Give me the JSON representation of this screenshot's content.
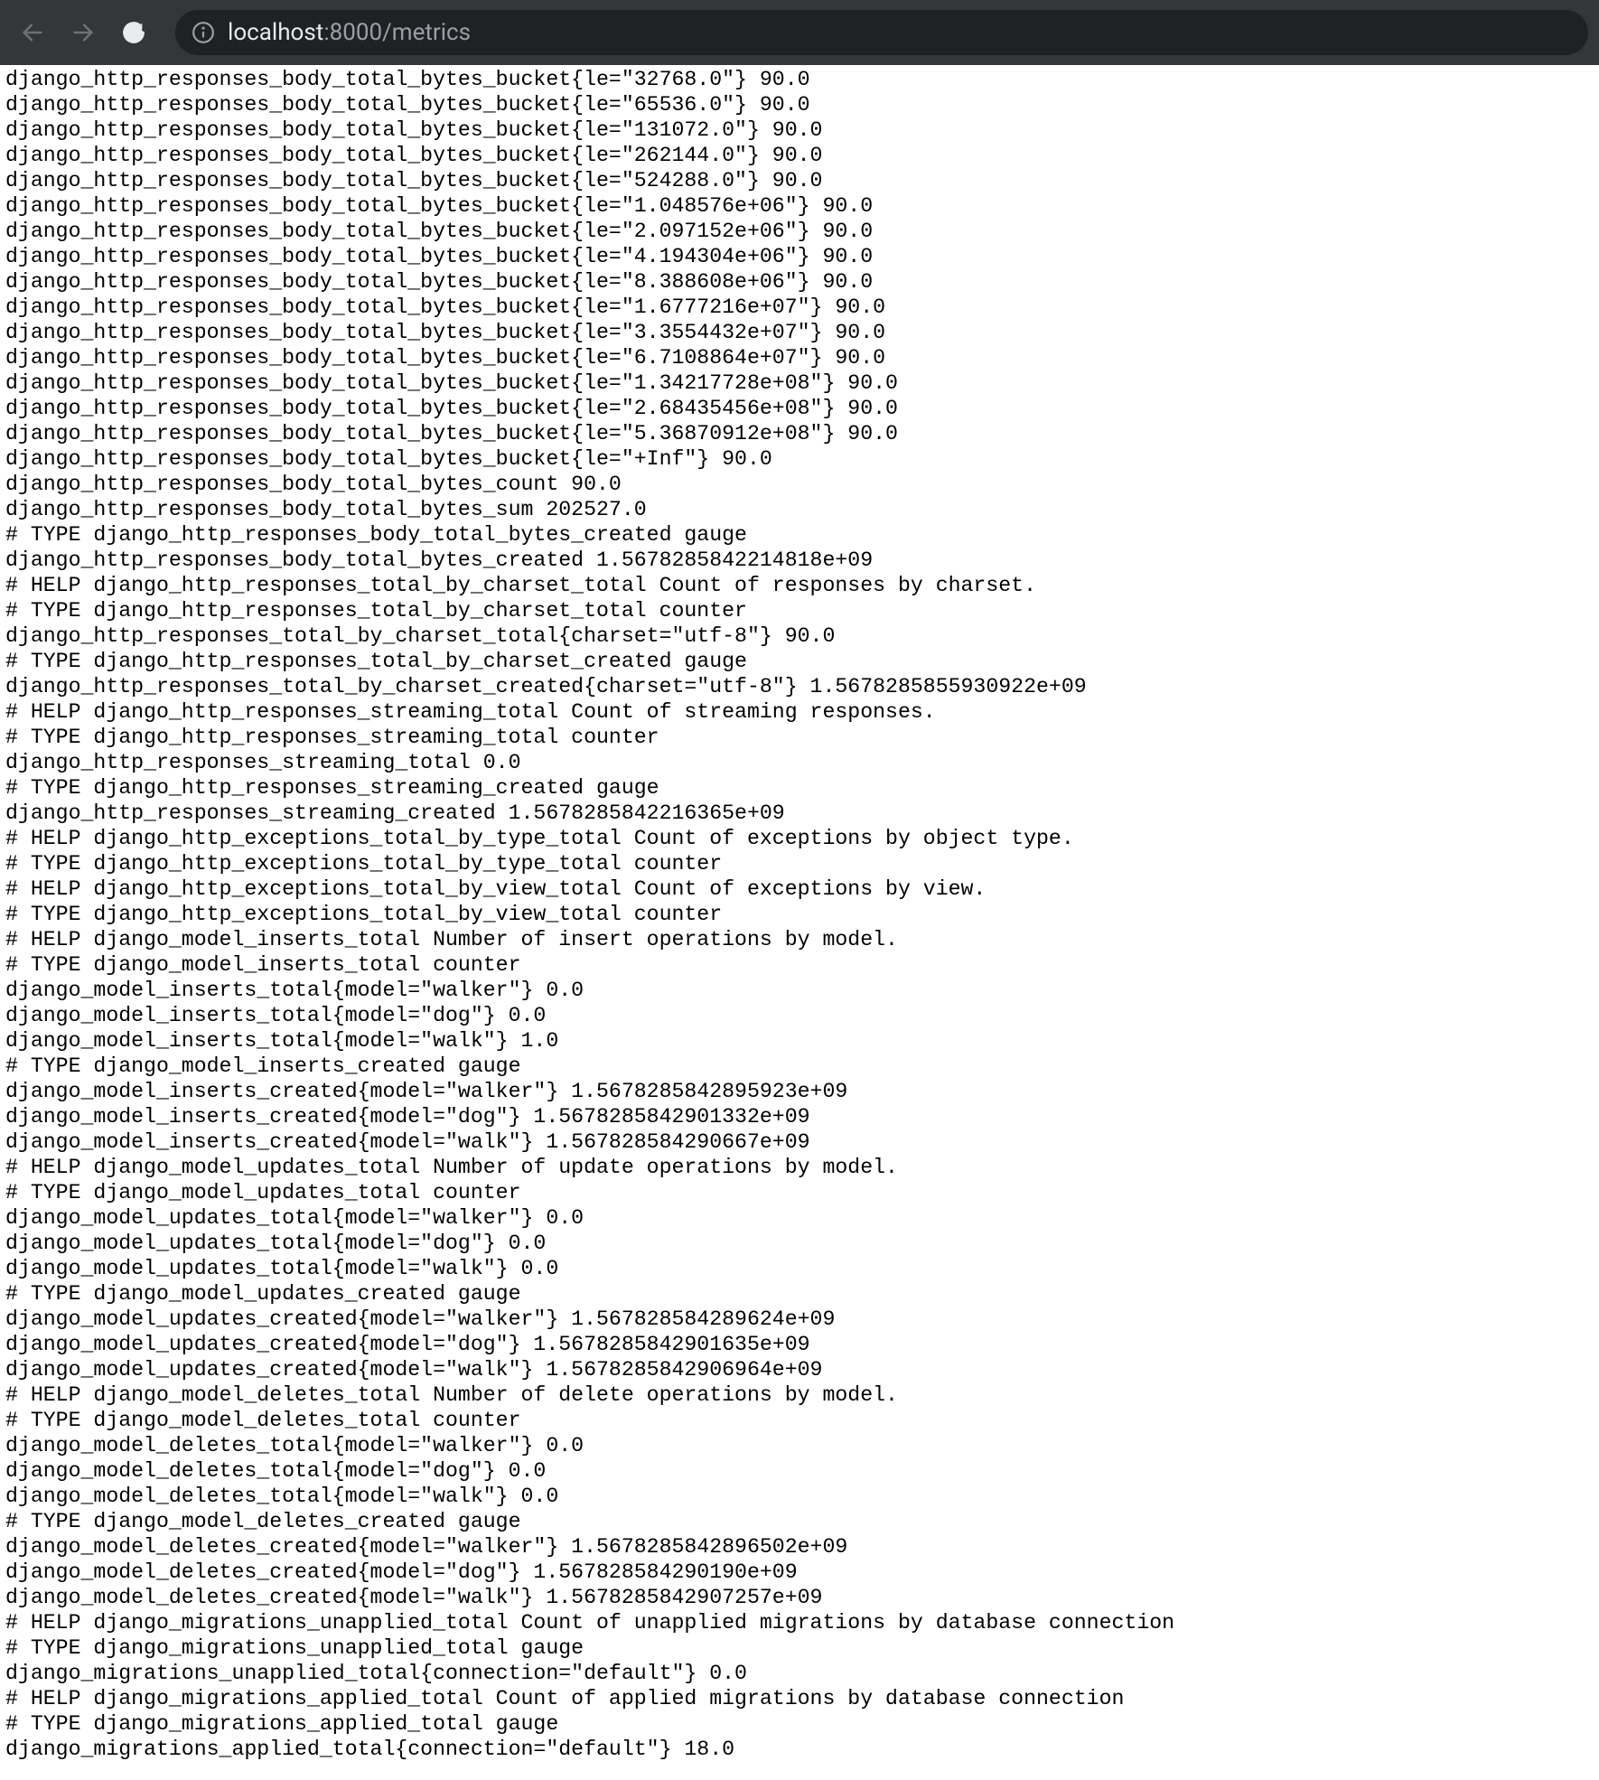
{
  "browser": {
    "url_host": "localhost",
    "url_port_path": ":8000/metrics"
  },
  "metrics_lines": [
    "django_http_responses_body_total_bytes_bucket{le=\"32768.0\"} 90.0",
    "django_http_responses_body_total_bytes_bucket{le=\"65536.0\"} 90.0",
    "django_http_responses_body_total_bytes_bucket{le=\"131072.0\"} 90.0",
    "django_http_responses_body_total_bytes_bucket{le=\"262144.0\"} 90.0",
    "django_http_responses_body_total_bytes_bucket{le=\"524288.0\"} 90.0",
    "django_http_responses_body_total_bytes_bucket{le=\"1.048576e+06\"} 90.0",
    "django_http_responses_body_total_bytes_bucket{le=\"2.097152e+06\"} 90.0",
    "django_http_responses_body_total_bytes_bucket{le=\"4.194304e+06\"} 90.0",
    "django_http_responses_body_total_bytes_bucket{le=\"8.388608e+06\"} 90.0",
    "django_http_responses_body_total_bytes_bucket{le=\"1.6777216e+07\"} 90.0",
    "django_http_responses_body_total_bytes_bucket{le=\"3.3554432e+07\"} 90.0",
    "django_http_responses_body_total_bytes_bucket{le=\"6.7108864e+07\"} 90.0",
    "django_http_responses_body_total_bytes_bucket{le=\"1.34217728e+08\"} 90.0",
    "django_http_responses_body_total_bytes_bucket{le=\"2.68435456e+08\"} 90.0",
    "django_http_responses_body_total_bytes_bucket{le=\"5.36870912e+08\"} 90.0",
    "django_http_responses_body_total_bytes_bucket{le=\"+Inf\"} 90.0",
    "django_http_responses_body_total_bytes_count 90.0",
    "django_http_responses_body_total_bytes_sum 202527.0",
    "# TYPE django_http_responses_body_total_bytes_created gauge",
    "django_http_responses_body_total_bytes_created 1.5678285842214818e+09",
    "# HELP django_http_responses_total_by_charset_total Count of responses by charset.",
    "# TYPE django_http_responses_total_by_charset_total counter",
    "django_http_responses_total_by_charset_total{charset=\"utf-8\"} 90.0",
    "# TYPE django_http_responses_total_by_charset_created gauge",
    "django_http_responses_total_by_charset_created{charset=\"utf-8\"} 1.5678285855930922e+09",
    "# HELP django_http_responses_streaming_total Count of streaming responses.",
    "# TYPE django_http_responses_streaming_total counter",
    "django_http_responses_streaming_total 0.0",
    "# TYPE django_http_responses_streaming_created gauge",
    "django_http_responses_streaming_created 1.5678285842216365e+09",
    "# HELP django_http_exceptions_total_by_type_total Count of exceptions by object type.",
    "# TYPE django_http_exceptions_total_by_type_total counter",
    "# HELP django_http_exceptions_total_by_view_total Count of exceptions by view.",
    "# TYPE django_http_exceptions_total_by_view_total counter",
    "# HELP django_model_inserts_total Number of insert operations by model.",
    "# TYPE django_model_inserts_total counter",
    "django_model_inserts_total{model=\"walker\"} 0.0",
    "django_model_inserts_total{model=\"dog\"} 0.0",
    "django_model_inserts_total{model=\"walk\"} 1.0",
    "# TYPE django_model_inserts_created gauge",
    "django_model_inserts_created{model=\"walker\"} 1.5678285842895923e+09",
    "django_model_inserts_created{model=\"dog\"} 1.5678285842901332e+09",
    "django_model_inserts_created{model=\"walk\"} 1.567828584290667e+09",
    "# HELP django_model_updates_total Number of update operations by model.",
    "# TYPE django_model_updates_total counter",
    "django_model_updates_total{model=\"walker\"} 0.0",
    "django_model_updates_total{model=\"dog\"} 0.0",
    "django_model_updates_total{model=\"walk\"} 0.0",
    "# TYPE django_model_updates_created gauge",
    "django_model_updates_created{model=\"walker\"} 1.567828584289624e+09",
    "django_model_updates_created{model=\"dog\"} 1.5678285842901635e+09",
    "django_model_updates_created{model=\"walk\"} 1.5678285842906964e+09",
    "# HELP django_model_deletes_total Number of delete operations by model.",
    "# TYPE django_model_deletes_total counter",
    "django_model_deletes_total{model=\"walker\"} 0.0",
    "django_model_deletes_total{model=\"dog\"} 0.0",
    "django_model_deletes_total{model=\"walk\"} 0.0",
    "# TYPE django_model_deletes_created gauge",
    "django_model_deletes_created{model=\"walker\"} 1.5678285842896502e+09",
    "django_model_deletes_created{model=\"dog\"} 1.567828584290190e+09",
    "django_model_deletes_created{model=\"walk\"} 1.5678285842907257e+09",
    "# HELP django_migrations_unapplied_total Count of unapplied migrations by database connection",
    "# TYPE django_migrations_unapplied_total gauge",
    "django_migrations_unapplied_total{connection=\"default\"} 0.0",
    "# HELP django_migrations_applied_total Count of applied migrations by database connection",
    "# TYPE django_migrations_applied_total gauge",
    "django_migrations_applied_total{connection=\"default\"} 18.0"
  ]
}
